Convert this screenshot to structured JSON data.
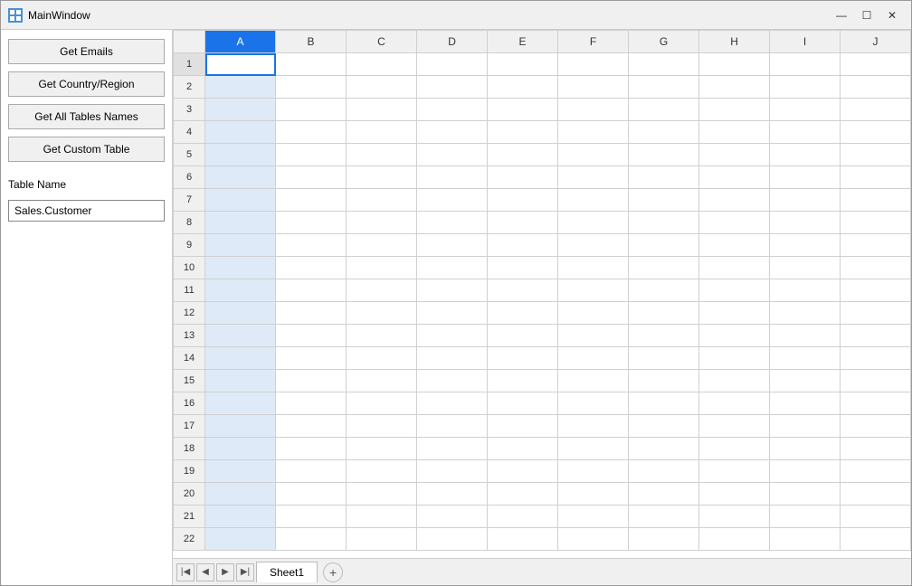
{
  "window": {
    "title": "MainWindow",
    "icon_label": "app-icon"
  },
  "title_controls": {
    "minimize_label": "—",
    "maximize_label": "☐",
    "close_label": "✕"
  },
  "sidebar": {
    "btn_emails": "Get Emails",
    "btn_country": "Get Country/Region",
    "btn_all_tables": "Get All Tables Names",
    "btn_custom_table": "Get Custom Table",
    "table_name_label": "Table Name",
    "table_name_value": "Sales.Customer"
  },
  "spreadsheet": {
    "columns": [
      "A",
      "B",
      "C",
      "D",
      "E",
      "F",
      "G",
      "H",
      "I",
      "J"
    ],
    "active_cell": "A1",
    "selected_col": "A",
    "rows": 22
  },
  "sheet_tabs": {
    "active_tab": "Sheet1",
    "add_btn_label": "+"
  }
}
